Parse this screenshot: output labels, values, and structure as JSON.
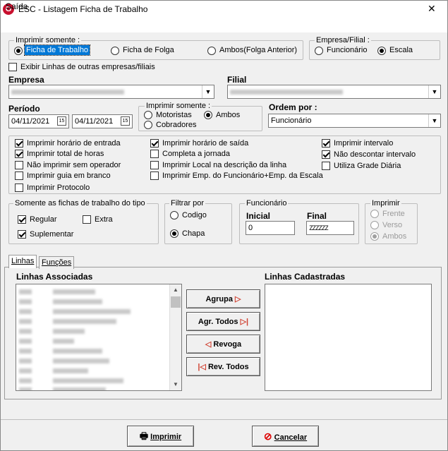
{
  "window": {
    "title": "ESC - Listagem Ficha de Trabalho",
    "close_glyph": "✕",
    "logo_letter": "G"
  },
  "menu": {
    "items": [
      "Saída"
    ]
  },
  "imprimir_somente_1": {
    "legend": "Imprimir somente :",
    "options": [
      "Ficha de Trabalho",
      "Ficha de Folga",
      "Ambos(Folga Anterior)"
    ],
    "selected": "Ficha de Trabalho"
  },
  "empresa_filial": {
    "legend": "Empresa/Filial :",
    "options": [
      "Funcionário",
      "Escala"
    ],
    "selected": "Escala"
  },
  "exibir_linhas": {
    "label": "Exibir Linhas de outras empresas/filiais",
    "checked": false
  },
  "empresa": {
    "label": "Empresa"
  },
  "filial": {
    "label": "Filial"
  },
  "periodo": {
    "label": "Período",
    "start": "04/11/2021",
    "end": "04/11/2021",
    "cal_glyph": "15"
  },
  "imprimir_somente_2": {
    "legend": "Imprimir somente :",
    "options": [
      "Motoristas",
      "Ambos",
      "Cobradores"
    ],
    "selected": "Ambos"
  },
  "ordem": {
    "label": "Ordem por :",
    "value": "Funcionário"
  },
  "options_checks": {
    "col1": [
      {
        "label": "Imprimir horário de entrada",
        "checked": true
      },
      {
        "label": "Imprimir total de horas",
        "checked": true
      },
      {
        "label": "Não imprimir sem operador",
        "checked": false
      },
      {
        "label": "Imprimir guia em branco",
        "checked": false
      },
      {
        "label": "Imprimir Protocolo",
        "checked": false
      }
    ],
    "col2": [
      {
        "label": "Imprimir horário de saída",
        "checked": true
      },
      {
        "label": "Completa a jornada",
        "checked": false
      },
      {
        "label": "Imprimir Local na descrição da linha",
        "checked": false
      },
      {
        "label": "Imprimir Emp. do Funcionário+Emp. da Escala",
        "checked": false
      }
    ],
    "col3": [
      {
        "label": "Imprimir intervalo",
        "checked": true
      },
      {
        "label": "Não descontar intervalo",
        "checked": true
      },
      {
        "label": "Utiliza Grade Diária",
        "checked": false
      }
    ]
  },
  "somente_fichas": {
    "legend": "Somente as fichas de trabalho do tipo",
    "regular": {
      "label": "Regular",
      "checked": true
    },
    "extra": {
      "label": "Extra",
      "checked": false
    },
    "suplementar": {
      "label": "Suplementar",
      "checked": true
    }
  },
  "filtrar": {
    "legend": "Filtrar por",
    "options": [
      "Codigo",
      "Chapa"
    ],
    "selected": "Chapa"
  },
  "funcionario": {
    "legend": "Funcionário",
    "inicial_label": "Inicial",
    "final_label": "Final",
    "inicial": "0",
    "final": "ZZZZZZ"
  },
  "imprimir_lado": {
    "legend": "Imprimir",
    "options": [
      "Frente",
      "Verso",
      "Ambos"
    ],
    "selected": "Ambos"
  },
  "tabs": [
    "Linhas",
    "Funções"
  ],
  "linhas": {
    "assoc_label": "Linhas Associadas",
    "cad_label": "Linhas Cadastradas",
    "scroll_up": "▲",
    "scroll_down": "▼"
  },
  "buttons": {
    "agrupa": "Agrupa",
    "agr_todos": "Agr. Todos",
    "revoga": "Revoga",
    "rev_todos": "Rev. Todos",
    "imprimir": "Imprimir",
    "cancelar": "Cancelar"
  },
  "colors": {
    "accent_red": "#c8102e",
    "selection_blue": "#0078d7"
  }
}
